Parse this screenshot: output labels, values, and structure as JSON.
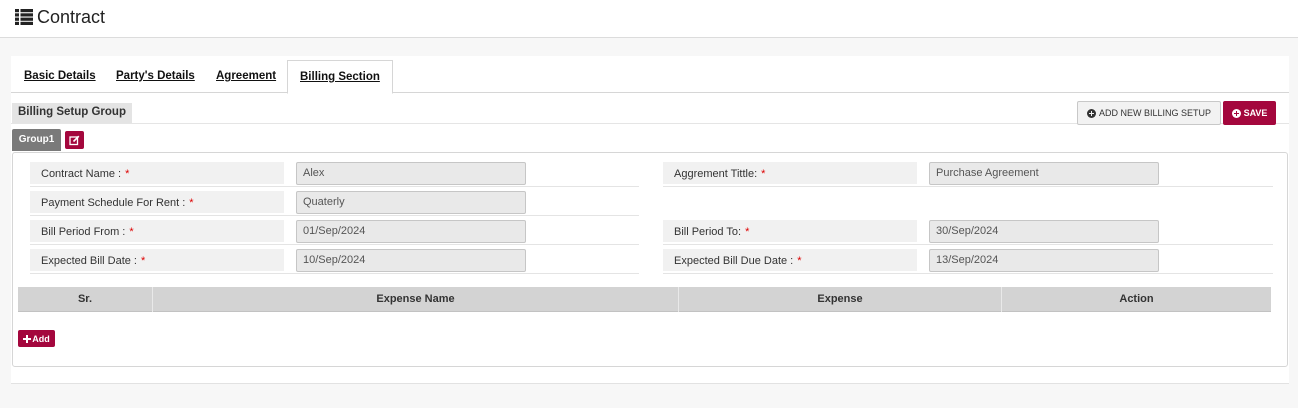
{
  "header": {
    "title": "Contract",
    "icon": "list-icon"
  },
  "tabs": [
    {
      "label": "Basic Details"
    },
    {
      "label": "Party's Details"
    },
    {
      "label": "Agreement"
    },
    {
      "label": "Billing Section",
      "active": true
    }
  ],
  "billing": {
    "section_title": "Billing Setup Group",
    "add_new_label": "ADD NEW BILLING SETUP",
    "save_label": "SAVE",
    "group_tab": "Group1",
    "fields": {
      "contract_name": {
        "label": "Contract Name :",
        "value": "Alex"
      },
      "agreement_title": {
        "label": "Aggrement Tittle:",
        "value": "Purchase Agreement"
      },
      "payment_schedule": {
        "label": "Payment Schedule For Rent :",
        "value": "Quaterly"
      },
      "bill_from": {
        "label": "Bill Period From :",
        "value": "01/Sep/2024"
      },
      "bill_to": {
        "label": "Bill Period To:",
        "value": "30/Sep/2024"
      },
      "bill_date": {
        "label": "Expected Bill Date :",
        "value": "10/Sep/2024"
      },
      "due_date": {
        "label": "Expected Bill Due Date :",
        "value": "13/Sep/2024"
      }
    },
    "required_marker": "*",
    "table": {
      "columns": [
        "Sr.",
        "Expense Name",
        "Expense",
        "Action"
      ]
    },
    "add_row_label": "Add"
  },
  "colors": {
    "accent": "#a4073d",
    "group_tab": "#7a7a7a",
    "table_header": "#d3d3d3"
  }
}
